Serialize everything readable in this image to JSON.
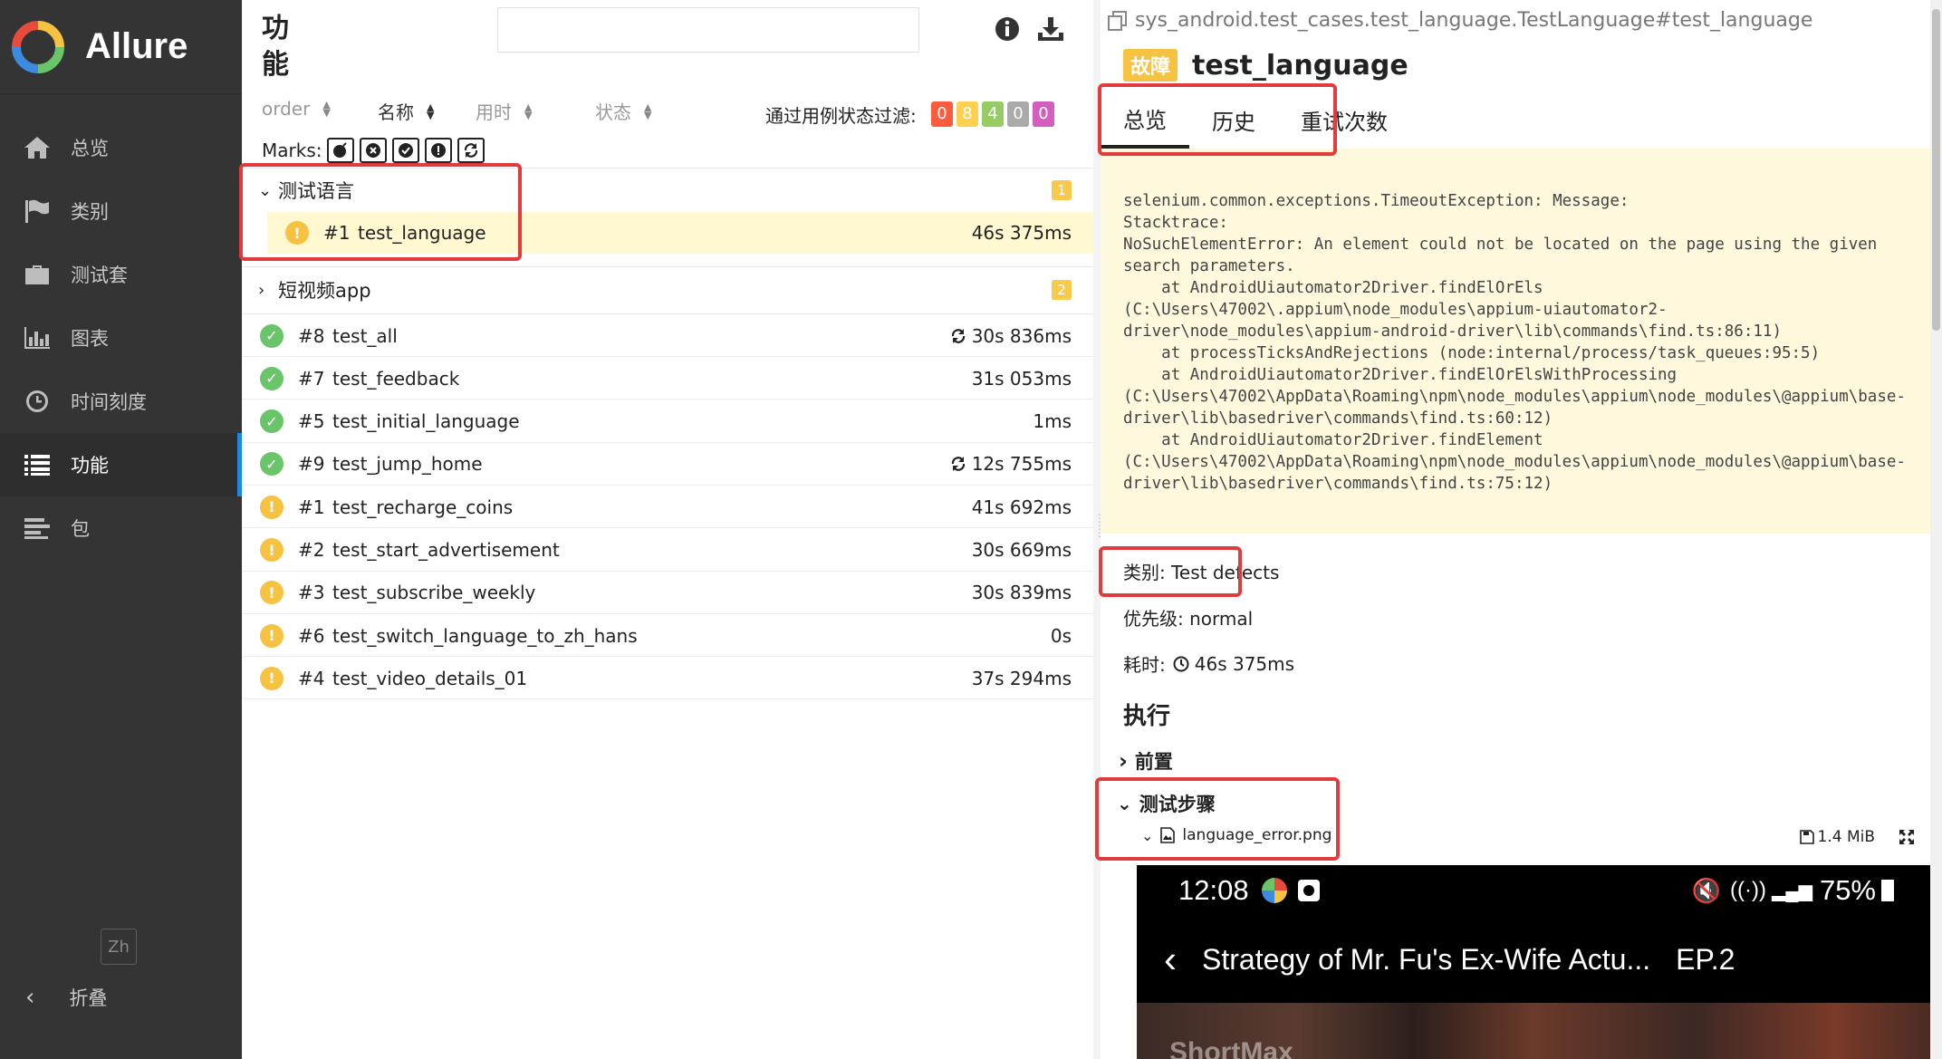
{
  "app": {
    "name": "Allure"
  },
  "sidebar": {
    "items": [
      {
        "label": "总览",
        "icon": "home-icon"
      },
      {
        "label": "类别",
        "icon": "flag-icon"
      },
      {
        "label": "测试套",
        "icon": "briefcase-icon"
      },
      {
        "label": "图表",
        "icon": "bar-chart-icon"
      },
      {
        "label": "时间刻度",
        "icon": "clock-icon"
      },
      {
        "label": "功能",
        "icon": "list-icon",
        "active": true
      },
      {
        "label": "包",
        "icon": "align-left-icon"
      }
    ],
    "language_button": "Zh",
    "collapse_label": "折叠"
  },
  "middle": {
    "title": "功能",
    "search": {
      "placeholder": "",
      "value": ""
    },
    "sort": {
      "order": "order",
      "name": "名称",
      "duration": "用时",
      "status": "状态"
    },
    "filter_label": "通过用例状态过滤:",
    "filter_badges": [
      {
        "value": "0",
        "color": "#fd5a3e"
      },
      {
        "value": "8",
        "color": "#ffd050"
      },
      {
        "value": "4",
        "color": "#97cc64"
      },
      {
        "value": "0",
        "color": "#aaaaaa"
      },
      {
        "value": "0",
        "color": "#d35ebe"
      }
    ],
    "marks_label": "Marks:",
    "groups": [
      {
        "name": "测试语言",
        "count": "1",
        "expanded": true,
        "tests": [
          {
            "num": "#1",
            "name": "test_language",
            "duration": "46s 375ms",
            "status": "broken",
            "retry": false,
            "selected": true
          }
        ]
      },
      {
        "name": "短视频app",
        "count": "2",
        "expanded": false,
        "tests": [
          {
            "num": "#8",
            "name": "test_all",
            "duration": "30s 836ms",
            "status": "passed",
            "retry": true
          },
          {
            "num": "#7",
            "name": "test_feedback",
            "duration": "31s 053ms",
            "status": "passed",
            "retry": false
          },
          {
            "num": "#5",
            "name": "test_initial_language",
            "duration": "1ms",
            "status": "passed",
            "retry": false
          },
          {
            "num": "#9",
            "name": "test_jump_home",
            "duration": "12s 755ms",
            "status": "passed",
            "retry": true
          },
          {
            "num": "#1",
            "name": "test_recharge_coins",
            "duration": "41s 692ms",
            "status": "broken",
            "retry": false
          },
          {
            "num": "#2",
            "name": "test_start_advertisement",
            "duration": "30s 669ms",
            "status": "broken",
            "retry": false
          },
          {
            "num": "#3",
            "name": "test_subscribe_weekly",
            "duration": "30s 839ms",
            "status": "broken",
            "retry": false
          },
          {
            "num": "#6",
            "name": "test_switch_language_to_zh_hans",
            "duration": "0s",
            "status": "broken",
            "retry": false
          },
          {
            "num": "#4",
            "name": "test_video_details_01",
            "duration": "37s 294ms",
            "status": "broken",
            "retry": false
          }
        ]
      }
    ]
  },
  "detail": {
    "path": "sys_android.test_cases.test_language.TestLanguage#test_language",
    "status_tag": "故障",
    "title": "test_language",
    "tabs": [
      "总览",
      "历史",
      "重试次数"
    ],
    "error_message": "selenium.common.exceptions.TimeoutException: Message: \nStacktrace:\nNoSuchElementError: An element could not be located on the page using the given\nsearch parameters.\n    at AndroidUiautomator2Driver.findElOrEls\n(C:\\Users\\47002\\.appium\\node_modules\\appium-uiautomator2-\ndriver\\node_modules\\appium-android-driver\\lib\\commands\\find.ts:86:11)\n    at processTicksAndRejections (node:internal/process/task_queues:95:5)\n    at AndroidUiautomator2Driver.findElOrElsWithProcessing\n(C:\\Users\\47002\\AppData\\Roaming\\npm\\node_modules\\appium\\node_modules\\@appium\\base-\ndriver\\lib\\basedriver\\commands\\find.ts:60:12)\n    at AndroidUiautomator2Driver.findElement\n(C:\\Users\\47002\\AppData\\Roaming\\npm\\node_modules\\appium\\node_modules\\@appium\\base-\ndriver\\lib\\basedriver\\commands\\find.ts:75:12)",
    "category": "类别: Test defects",
    "severity": "优先级: normal",
    "duration_label": "耗时:",
    "duration_value": "46s 375ms",
    "execution_title": "执行",
    "setup_label": "前置",
    "steps_label": "测试步骤",
    "attachment": {
      "name": "language_error.png",
      "size": "1.4 MiB"
    },
    "phone": {
      "time": "12:08",
      "battery": "75%",
      "title": "Strategy of Mr. Fu's Ex-Wife Actu...",
      "episode": "EP.2",
      "watermark": "ShortMax"
    }
  }
}
